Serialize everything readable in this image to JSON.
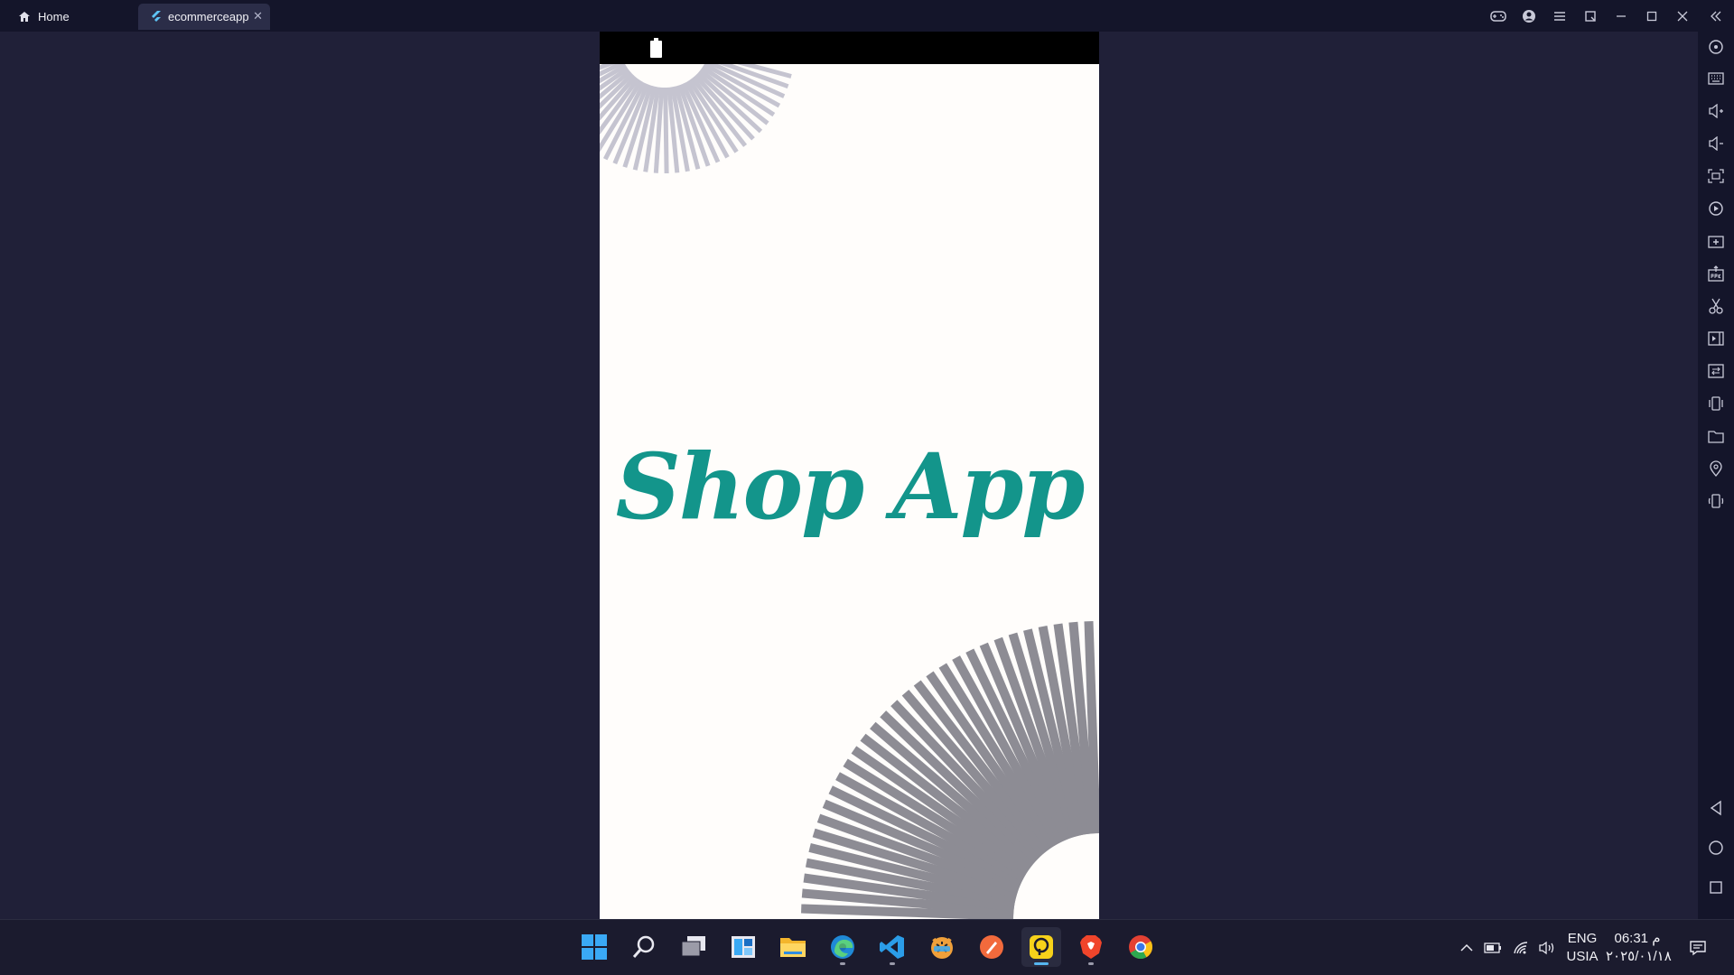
{
  "window": {
    "tabs": [
      {
        "label": "Home",
        "icon": "home-icon"
      },
      {
        "label": "ecommerceapp",
        "icon": "flutter-icon",
        "close_icon": "close-icon"
      }
    ],
    "top_icons": [
      "gamepad-icon",
      "account-icon",
      "menu-icon",
      "restore-icon",
      "minimize-icon",
      "maximize-icon",
      "close-icon"
    ],
    "sidebar_icons": [
      "collapse-icon",
      "location-target-icon",
      "keyboard-icon",
      "volume-up-icon",
      "volume-down-icon",
      "screenshot-icon",
      "record-icon",
      "import-icon",
      "apk-icon",
      "cut-icon",
      "video-icon",
      "list-icon",
      "shake-icon",
      "folder-icon",
      "location-pin-icon",
      "rotate-icon"
    ],
    "nav_icons": [
      "back-icon",
      "home-circle-icon",
      "recents-icon"
    ]
  },
  "phone": {
    "app_title": "Shop App",
    "title_color": "#13958b",
    "background": "#fffdfb",
    "status_bar_icon": "battery-icon"
  },
  "taskbar": {
    "apps": [
      "windows-start-icon",
      "search-icon",
      "task-view-icon",
      "widgets-icon",
      "file-explorer-icon",
      "edge-icon",
      "vscode-icon",
      "tiger-app-icon",
      "compass-app-icon",
      "emulator-app-icon",
      "brave-icon",
      "chrome-icon"
    ],
    "language": "ENG",
    "keyboard": "USIA",
    "time": "06:31 م",
    "date": "٢٠٢٥/٠١/١٨"
  }
}
